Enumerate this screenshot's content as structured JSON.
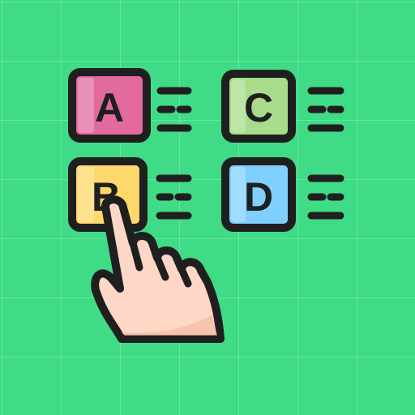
{
  "options": [
    {
      "letter": "A",
      "color": "#e36a9e",
      "shade": "#c94f86"
    },
    {
      "letter": "C",
      "color": "#a8dc8a",
      "shade": "#8cc36f"
    },
    {
      "letter": "B",
      "color": "#ffd86b",
      "shade": "#f4bf3f"
    },
    {
      "letter": "D",
      "color": "#7fd0ff",
      "shade": "#5cb7f2"
    }
  ],
  "selected_option": "B",
  "colors": {
    "background": "#3fdb86",
    "outline": "#1f1f1f",
    "skin": "#ffd7c7",
    "skin_shade": "#f5b9a3"
  }
}
